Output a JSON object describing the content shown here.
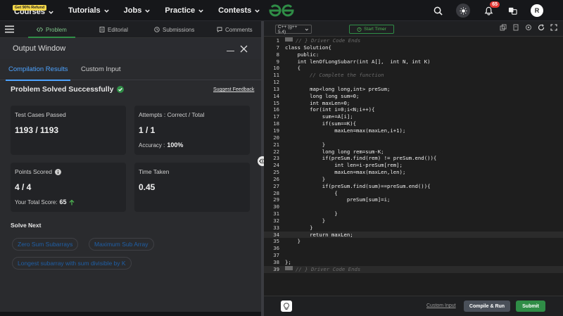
{
  "nav": {
    "promo": "Get 90% Refund",
    "items": [
      "Courses",
      "Tutorials",
      "Jobs",
      "Practice",
      "Contests"
    ]
  },
  "header": {
    "notification_count": "65",
    "avatar_letter": "R"
  },
  "problem_tabs": [
    "Problem",
    "Editorial",
    "Submissions",
    "Comments"
  ],
  "output": {
    "title": "Output Window",
    "tabs": [
      "Compilation Results",
      "Custom Input"
    ],
    "status": "Problem Solved Successfully",
    "feedback": "Suggest Feedback",
    "cards": {
      "test_cases_label": "Test Cases Passed",
      "test_cases_value": "1193 / 1193",
      "attempts_label": "Attempts : Correct / Total",
      "attempts_value": "1 / 1",
      "accuracy_label": "Accuracy :",
      "accuracy_value": "100%",
      "points_label": "Points Scored",
      "points_value": "4 / 4",
      "total_score_label": "Your Total Score:",
      "total_score_value": "65",
      "time_label": "Time Taken",
      "time_value": "0.45"
    },
    "solve_next_title": "Solve Next",
    "solve_next": [
      "Zero Sum Subarrays",
      "Maximum Sub Array",
      "Longest subarray with sum divisible by K"
    ]
  },
  "editor": {
    "language": "C++ (g++ 5.4)",
    "timer": "Start Timer",
    "lines": [
      {
        "n": "1",
        "t": "// } Driver Code Ends",
        "c": "cmt",
        "m": true
      },
      {
        "n": "7",
        "t": "class Solution{"
      },
      {
        "n": "8",
        "t": "    public:"
      },
      {
        "n": "9",
        "t": "    int lenOfLongSubarr(int A[],  int N, int K)"
      },
      {
        "n": "10",
        "t": "    {"
      },
      {
        "n": "11",
        "t": "        // Complete the function",
        "c": "cmt"
      },
      {
        "n": "12",
        "t": ""
      },
      {
        "n": "13",
        "t": "        map<long long,int> preSum;"
      },
      {
        "n": "14",
        "t": "        long long sum=0;"
      },
      {
        "n": "15",
        "t": "        int maxLen=0;"
      },
      {
        "n": "16",
        "t": "        for(int i=0;i<N;i++){"
      },
      {
        "n": "17",
        "t": "            sum+=A[i];"
      },
      {
        "n": "18",
        "t": "            if(sum==K){"
      },
      {
        "n": "19",
        "t": "                maxLen=max(maxLen,i+1);"
      },
      {
        "n": "20",
        "t": ""
      },
      {
        "n": "21",
        "t": "            }"
      },
      {
        "n": "22",
        "t": "            long long rem=sum-K;"
      },
      {
        "n": "23",
        "t": "            if(preSum.find(rem) != preSum.end()){"
      },
      {
        "n": "24",
        "t": "                int len=i-preSum[rem];"
      },
      {
        "n": "25",
        "t": "                maxLen=max(maxLen,len);"
      },
      {
        "n": "26",
        "t": "            }"
      },
      {
        "n": "27",
        "t": "            if(preSum.find(sum)==preSum.end()){"
      },
      {
        "n": "28",
        "t": "                {"
      },
      {
        "n": "29",
        "t": "                    preSum[sum]=i;"
      },
      {
        "n": "30",
        "t": ""
      },
      {
        "n": "31",
        "t": "                }"
      },
      {
        "n": "32",
        "t": "            }"
      },
      {
        "n": "33",
        "t": "        }"
      },
      {
        "n": "34",
        "t": "        return maxLen;",
        "h": true
      },
      {
        "n": "35",
        "t": "    }"
      },
      {
        "n": "36",
        "t": ""
      },
      {
        "n": "37",
        "t": ""
      },
      {
        "n": "38",
        "t": "};"
      },
      {
        "n": "39",
        "t": "// } Driver Code Ends",
        "c": "cmt",
        "m": true,
        "h": true
      }
    ],
    "custom_input": "Custom Input",
    "compile_run": "Compile & Run",
    "submit": "Submit"
  },
  "colors": {
    "accent_green": "#2f8d46",
    "link_blue": "#4da3ff",
    "badge_red": "#e53935"
  }
}
